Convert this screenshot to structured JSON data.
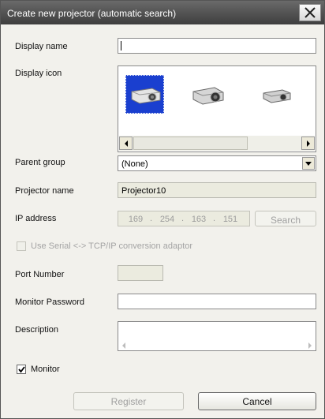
{
  "title": "Create new projector (automatic search)",
  "labels": {
    "display_name": "Display name",
    "display_icon": "Display icon",
    "parent_group": "Parent group",
    "projector_name": "Projector name",
    "ip_address": "IP address",
    "use_serial": "Use Serial <-> TCP/IP conversion adaptor",
    "port_number": "Port Number",
    "monitor_password": "Monitor Password",
    "description": "Description",
    "monitor": "Monitor"
  },
  "fields": {
    "display_name_value": "",
    "parent_group_value": "(None)",
    "projector_name_value": "Projector10",
    "ip_octets": [
      "169",
      "254",
      "163",
      "151"
    ],
    "port_number_value": "",
    "monitor_password_value": "",
    "description_value": ""
  },
  "checks": {
    "use_serial": false,
    "monitor": true
  },
  "buttons": {
    "search": "Search",
    "register": "Register",
    "cancel": "Cancel"
  },
  "colors": {
    "titlebar": "#4a4a4a",
    "selected_icon_bg": "#1a3fcf",
    "dialog_bg": "#f2f1ec"
  },
  "icons": [
    "projector-icon-selected",
    "projector-icon",
    "projector-icon-small"
  ]
}
